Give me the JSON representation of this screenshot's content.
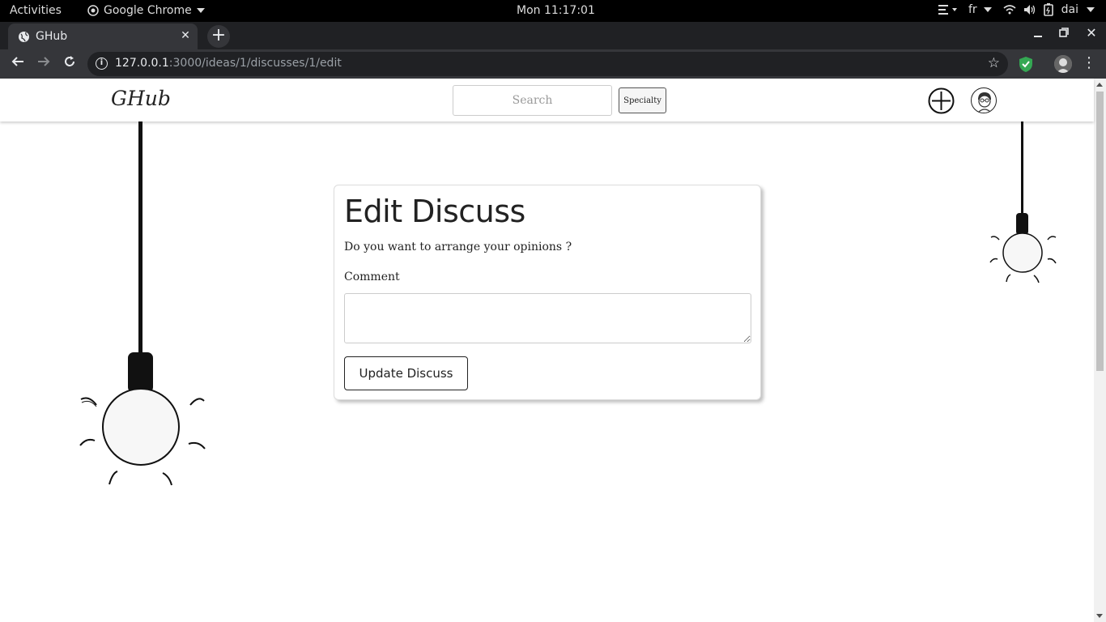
{
  "system_bar": {
    "activities": "Activities",
    "app_name": "Google Chrome",
    "clock": "Mon 11:17:01",
    "input_lang": "fr",
    "user": "dai"
  },
  "browser": {
    "tab_title": "GHub",
    "url_host": "127.0.0.1",
    "url_rest": ":3000/ideas/1/discusses/1/edit"
  },
  "site": {
    "brand": "GHub",
    "search_placeholder": "Search",
    "specialty_label": "Specialty"
  },
  "form": {
    "heading": "Edit Discuss",
    "lead": "Do you want to arrange your opinions ?",
    "comment_label": "Comment",
    "comment_value": "",
    "submit_label": "Update Discuss"
  },
  "colors": {
    "system_bar_bg": "#000000",
    "tab_strip_bg": "#202124",
    "toolbar_bg": "#35363a",
    "shield_green": "#34a853"
  }
}
